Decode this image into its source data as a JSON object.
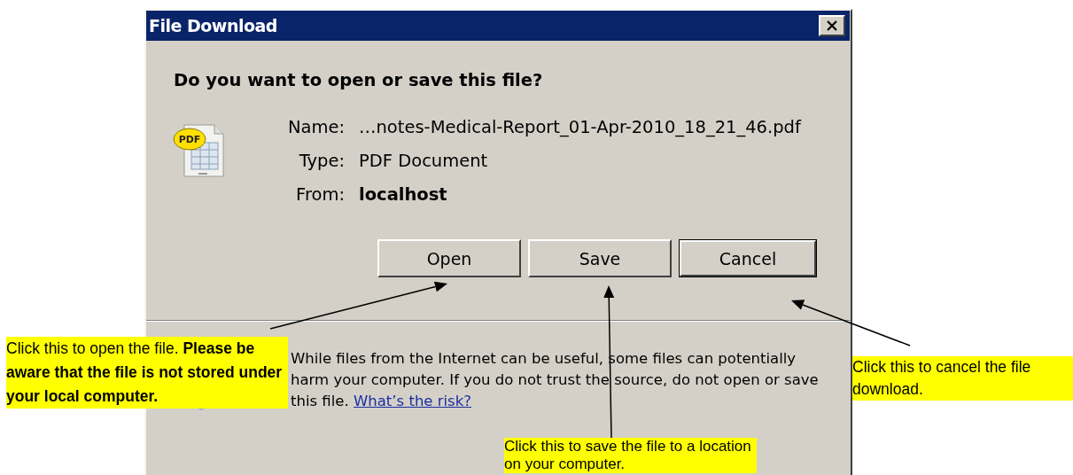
{
  "window": {
    "title": "File Download"
  },
  "heading": "Do you want to open or save this file?",
  "file": {
    "icon_label": "PDF",
    "fields": [
      {
        "label": "Name:",
        "value": "…notes-Medical-Report_01-Apr-2010_18_21_46.pdf",
        "bold": false
      },
      {
        "label": "Type:",
        "value": "PDF Document",
        "bold": false
      },
      {
        "label": "From:",
        "value": "localhost",
        "bold": true
      }
    ]
  },
  "buttons": [
    {
      "label": "Open",
      "default": false
    },
    {
      "label": "Save",
      "default": false
    },
    {
      "label": "Cancel",
      "default": true
    }
  ],
  "warning": {
    "text": "While files from the Internet can be useful, some files can potentially harm your computer. If you do not trust the source, do not open or save this file.",
    "link": "What’s the risk?"
  },
  "annotations": [
    {
      "text": "Click this to open the file. **Please be aware that the file is not stored under your local computer.**"
    },
    {
      "text": "Click this to cancel the file download."
    },
    {
      "text": "Click this to save the file to a location on your computer."
    }
  ]
}
